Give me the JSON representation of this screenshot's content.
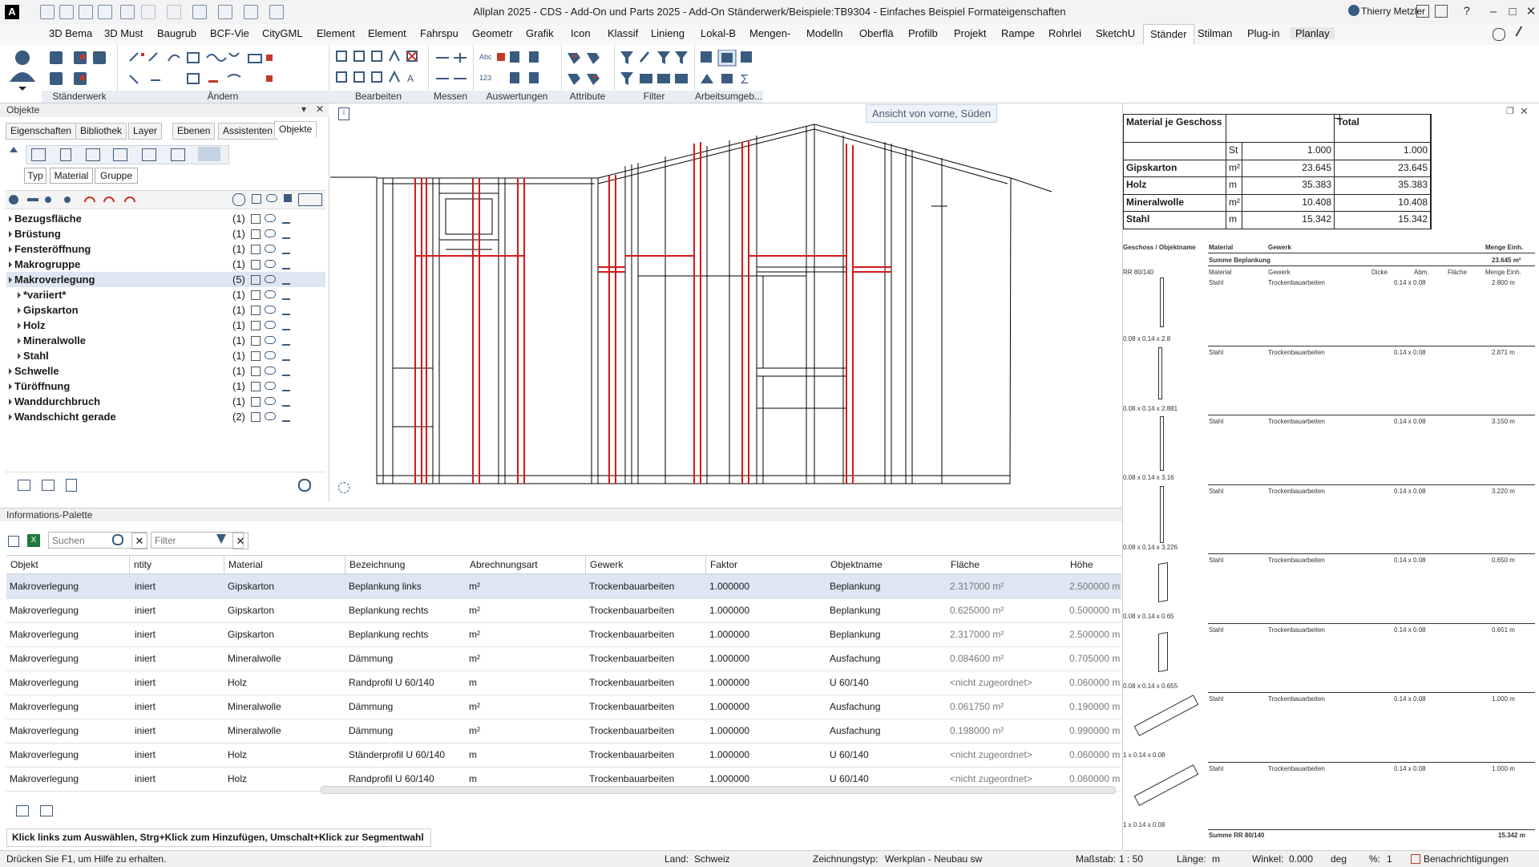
{
  "window": {
    "app_logo": "A",
    "title": "Allplan 2025 - CDS - Add-On und Parts 2025 - Add-On Ständerwerk/Beispiele:TB9304 - Einfaches Beispiel Formateigenschaften",
    "user": "Thierry Metzler"
  },
  "menu": {
    "tabs": [
      "3D Bema",
      "3D Must",
      "Baugrub",
      "BCF-Vie",
      "CityGML",
      "Element",
      "Element",
      "Fahrspu",
      "Geometr",
      "Grafik",
      "Icon",
      "Klassif",
      "Linieng",
      "Lokal-B",
      "Mengen-",
      "Modelln",
      "Oberflä",
      "Profilb",
      "Projekt",
      "Rampe",
      "Rohrlei",
      "SketchU",
      "Ständer",
      "Stilman",
      "Plug-in",
      "Planlay"
    ],
    "active": "Ständer"
  },
  "ribbon": {
    "groups": [
      "Ständerwerk",
      "Ändern",
      "Bearbeiten",
      "Messen",
      "Auswertungen",
      "Attribute",
      "Filter",
      "Arbeitsumgeb..."
    ]
  },
  "objects_panel": {
    "title": "Objekte",
    "tabs": [
      "Eigenschaften",
      "Bibliothek",
      "Layer",
      "Ebenen",
      "Assistenten",
      "Objekte"
    ],
    "active_tab": "Objekte",
    "filter_buttons": [
      "Typ",
      "Material",
      "Gruppe"
    ],
    "tree": [
      {
        "label": "Bezugsfläche",
        "count": "(1)",
        "level": 0,
        "sel": false
      },
      {
        "label": "Brüstung",
        "count": "(1)",
        "level": 0,
        "sel": false
      },
      {
        "label": "Fensteröffnung",
        "count": "(1)",
        "level": 0,
        "sel": false
      },
      {
        "label": "Makrogruppe",
        "count": "(1)",
        "level": 0,
        "sel": false
      },
      {
        "label": "Makroverlegung",
        "count": "(5)",
        "level": 0,
        "sel": true
      },
      {
        "label": "*variiert*",
        "count": "(1)",
        "level": 1,
        "sel": false
      },
      {
        "label": "Gipskarton",
        "count": "(1)",
        "level": 1,
        "sel": false
      },
      {
        "label": "Holz",
        "count": "(1)",
        "level": 1,
        "sel": false
      },
      {
        "label": "Mineralwolle",
        "count": "(1)",
        "level": 1,
        "sel": false
      },
      {
        "label": "Stahl",
        "count": "(1)",
        "level": 1,
        "sel": false
      },
      {
        "label": "Schwelle",
        "count": "(1)",
        "level": 0,
        "sel": false
      },
      {
        "label": "Türöffnung",
        "count": "(1)",
        "level": 0,
        "sel": false
      },
      {
        "label": "Wanddurchbruch",
        "count": "(1)",
        "level": 0,
        "sel": false
      },
      {
        "label": "Wandschicht gerade",
        "count": "(2)",
        "level": 0,
        "sel": false
      }
    ]
  },
  "viewport": {
    "view_label": "Ansicht von vorne, Süden"
  },
  "info_palette": {
    "title": "Informations-Palette",
    "search_placeholder": "Suchen",
    "filter_placeholder": "Filter",
    "columns": [
      "Objekt",
      "ntity",
      "Material",
      "Bezeichnung",
      "Abrechnungsart",
      "Gewerk",
      "Faktor",
      "Objektname",
      "Fläche",
      "Höhe"
    ],
    "rows": [
      [
        "Makroverlegung",
        "iniert",
        "Gipskarton",
        "Beplankung links",
        "m²",
        "Trockenbauarbeiten",
        "1.000000",
        "Beplankung",
        "2.317000 m²",
        "2.500000 m"
      ],
      [
        "Makroverlegung",
        "iniert",
        "Gipskarton",
        "Beplankung rechts",
        "m²",
        "Trockenbauarbeiten",
        "1.000000",
        "Beplankung",
        "0.625000 m²",
        "0.500000 m"
      ],
      [
        "Makroverlegung",
        "iniert",
        "Gipskarton",
        "Beplankung rechts",
        "m²",
        "Trockenbauarbeiten",
        "1.000000",
        "Beplankung",
        "2.317000 m²",
        "2.500000 m"
      ],
      [
        "Makroverlegung",
        "iniert",
        "Mineralwolle",
        "Dämmung",
        "m²",
        "Trockenbauarbeiten",
        "1.000000",
        "Ausfachung",
        "0.084600 m²",
        "0.705000 m"
      ],
      [
        "Makroverlegung",
        "iniert",
        "Holz",
        "Randprofil U 60/140",
        "m",
        "Trockenbauarbeiten",
        "1.000000",
        "U 60/140",
        "<nicht zugeordnet>",
        "0.060000 m"
      ],
      [
        "Makroverlegung",
        "iniert",
        "Mineralwolle",
        "Dämmung",
        "m²",
        "Trockenbauarbeiten",
        "1.000000",
        "Ausfachung",
        "0.061750 m²",
        "0.190000 m"
      ],
      [
        "Makroverlegung",
        "iniert",
        "Mineralwolle",
        "Dämmung",
        "m²",
        "Trockenbauarbeiten",
        "1.000000",
        "Ausfachung",
        "0.198000 m²",
        "0.990000 m"
      ],
      [
        "Makroverlegung",
        "iniert",
        "Holz",
        "Ständerprofil U 60/140",
        "m",
        "Trockenbauarbeiten",
        "1.000000",
        "U 60/140",
        "<nicht zugeordnet>",
        "0.060000 m"
      ],
      [
        "Makroverlegung",
        "iniert",
        "Holz",
        "Randprofil U 60/140",
        "m",
        "Trockenbauarbeiten",
        "1.000000",
        "U 60/140",
        "<nicht zugeordnet>",
        "0.060000 m"
      ]
    ],
    "hint": "Klick links zum Auswählen, Strg+Klick zum Hinzufügen, Umschalt+Klick zur Segmentwahl"
  },
  "material_table": {
    "header": [
      "Material je Geschoss",
      "",
      "",
      "Total"
    ],
    "rows": [
      [
        "",
        "St",
        "1.000",
        "1.000"
      ],
      [
        "Gipskarton",
        "m²",
        "23.645",
        "23.645"
      ],
      [
        "Holz",
        "m",
        "35.383",
        "35.383"
      ],
      [
        "Mineralwolle",
        "m²",
        "10.408",
        "10.408"
      ],
      [
        "Stahl",
        "m",
        "15.342",
        "15.342"
      ]
    ]
  },
  "legend": {
    "header": [
      "Geschoss / Objektname",
      "Material",
      "Gewerk",
      "Menge Einh."
    ],
    "sum_beplankung": "Summe Beplankung",
    "sum_beplankung_value": "23.645 m²",
    "group": "RR 80/140",
    "sub_header": [
      "Material",
      "Gewerk",
      "Dicke",
      "Abm.",
      "Fläche",
      "Menge Einh."
    ],
    "items": [
      {
        "material": "Stahl",
        "gewerk": "Trockenbauarbeiten",
        "abm": "0.14 x 0.08",
        "menge": "2.800 m",
        "dim": "0.08 x 0.14 x 2.8"
      },
      {
        "material": "Stahl",
        "gewerk": "Trockenbauarbeiten",
        "abm": "0.14 x 0.08",
        "menge": "2.871 m",
        "dim": "0.08 x 0.14 x 2.881"
      },
      {
        "material": "Stahl",
        "gewerk": "Trockenbauarbeiten",
        "abm": "0.14 x 0.08",
        "menge": "3.150 m",
        "dim": "0.08 x 0.14 x 3.16"
      },
      {
        "material": "Stahl",
        "gewerk": "Trockenbauarbeiten",
        "abm": "0.14 x 0.08",
        "menge": "3.220 m",
        "dim": "0.08 x 0.14 x 3.226"
      },
      {
        "material": "Stahl",
        "gewerk": "Trockenbauarbeiten",
        "abm": "0.14 x 0.08",
        "menge": "0.650 m",
        "dim": "0.08 x 0.14 x 0.65"
      },
      {
        "material": "Stahl",
        "gewerk": "Trockenbauarbeiten",
        "abm": "0.14 x 0.08",
        "menge": "0.651 m",
        "dim": "0.08 x 0.14 x 0.655"
      },
      {
        "material": "Stahl",
        "gewerk": "Trockenbauarbeiten",
        "abm": "0.14 x 0.08",
        "menge": "1.000 m",
        "dim": "1 x 0.14 x 0.08"
      },
      {
        "material": "Stahl",
        "gewerk": "Trockenbauarbeiten",
        "abm": "0.14 x 0.08",
        "menge": "1.000 m",
        "dim": "1 x 0.14 x 0.08"
      }
    ],
    "sum_rr": "Summe RR 80/140",
    "sum_rr_value": "15.342 m"
  },
  "status": {
    "help": "Drücken Sie F1, um Hilfe zu erhalten.",
    "land_label": "Land:",
    "land": "Schweiz",
    "zeichnungstyp_label": "Zeichnungstyp:",
    "zeichnungstyp": "Werkplan - Neubau sw",
    "massstab_label": "Maßstab:",
    "massstab": "1 : 50",
    "laenge_label": "Länge:",
    "laenge": "m",
    "winkel_label": "Winkel:",
    "winkel": "0.000",
    "winkel_unit": "deg",
    "prozent_label": "%:",
    "prozent": "1",
    "benachrichtigungen": "Benachrichtigungen"
  }
}
